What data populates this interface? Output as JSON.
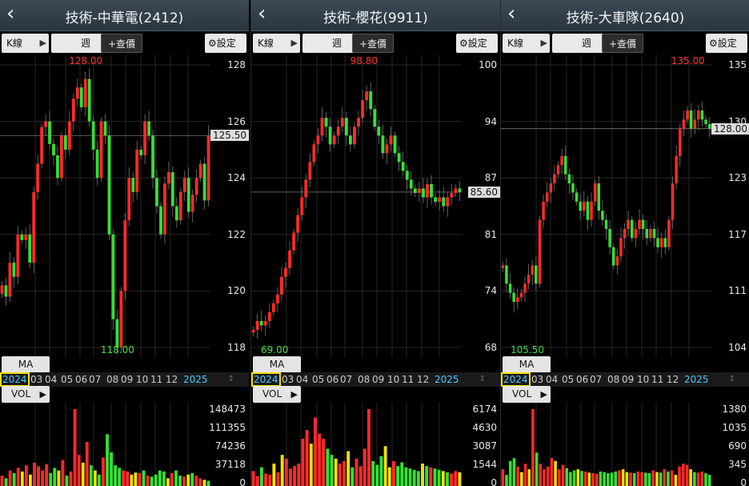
{
  "colors": {
    "up": "#ff2a2a",
    "down": "#35e035",
    "vol_yellow": "#f4e000",
    "accent_year": "#4cc4ff",
    "highlight": "#f0e000"
  },
  "toolbar": {
    "k_label": "K線",
    "week_label": "週",
    "query_label": "+查價",
    "setting_label": "設定",
    "back_icon": "chevron-left-icon",
    "setting_icon": "gear-icon"
  },
  "indicators": {
    "ma_label": "MA",
    "vol_label": "VOL"
  },
  "panels": [
    {
      "title": "技術-中華電(2412)",
      "high_label": "128.00",
      "low_label": "118.00",
      "last_label": "125.50",
      "y_ticks": [
        "128",
        "126",
        "124",
        "122",
        "120",
        "118"
      ],
      "vol_ticks": [
        "148473",
        "111355",
        "74236",
        "37118",
        "0"
      ],
      "timeline": [
        "2024",
        "03",
        "04",
        "05",
        "06",
        "07",
        "08",
        "09",
        "10",
        "11",
        "12",
        "2025"
      ]
    },
    {
      "title": "技術-櫻花(9911)",
      "high_label": "98.80",
      "low_label": "69.00",
      "last_label": "85.60",
      "y_ticks": [
        "100",
        "94",
        "87",
        "81",
        "74",
        "68"
      ],
      "vol_ticks": [
        "6174",
        "4630",
        "3087",
        "1544",
        "0"
      ],
      "timeline": [
        "2024",
        "03",
        "04",
        "05",
        "06",
        "07",
        "08",
        "09",
        "10",
        "11",
        "12",
        "2025"
      ]
    },
    {
      "title": "技術-大車隊(2640)",
      "high_label": "135.00",
      "low_label": "105.50",
      "last_label": "128.00",
      "y_ticks": [
        "135",
        "130",
        "123",
        "117",
        "111",
        "104"
      ],
      "vol_ticks": [
        "1380",
        "1035",
        "690",
        "345",
        "0"
      ],
      "timeline": [
        "2024",
        "03",
        "04",
        "05",
        "06",
        "07",
        "08",
        "09",
        "10",
        "11",
        "12",
        "2025"
      ]
    }
  ],
  "chart_data": [
    {
      "type": "candlestick",
      "title": "技術-中華電(2412)",
      "ylim": [
        118,
        128
      ],
      "last": 125.5,
      "closes": [
        120.2,
        119.8,
        121,
        120.5,
        122,
        121.8,
        122,
        121,
        123.5,
        124.5,
        125.8,
        126,
        125.2,
        124.8,
        124,
        125.5,
        125,
        126,
        126.8,
        127.2,
        126.5,
        127.5,
        126,
        125,
        124,
        126,
        125.5,
        122,
        119,
        118,
        120,
        122.5,
        124,
        123.5,
        125,
        124.8,
        126,
        125.5,
        124,
        123,
        122,
        123.8,
        124.2,
        123,
        122.5,
        123.5,
        124,
        122.8,
        123.4,
        124,
        124.5,
        123.2,
        125.5
      ],
      "volume": [
        20000,
        15000,
        30000,
        25000,
        35000,
        28000,
        40000,
        22000,
        45000,
        38000,
        30000,
        42000,
        25000,
        35000,
        30000,
        50000,
        20000,
        28000,
        148473,
        60000,
        45000,
        85000,
        40000,
        30000,
        22000,
        55000,
        100000,
        65000,
        40000,
        35000,
        30000,
        28000,
        22000,
        26000,
        25000,
        30000,
        20000,
        18000,
        22000,
        30000,
        28000,
        15000,
        25000,
        30000,
        20000,
        18000,
        22000,
        25000,
        20000,
        15000,
        12000,
        10000
      ]
    },
    {
      "type": "candlestick",
      "title": "技術-櫻花(9911)",
      "ylim": [
        68,
        100
      ],
      "last": 85.6,
      "closes": [
        70,
        71,
        70.5,
        71,
        72,
        73,
        74,
        76,
        77,
        79,
        81,
        83,
        85,
        87,
        89,
        91,
        92,
        94,
        93,
        91,
        92,
        93,
        94,
        92,
        91,
        93,
        94,
        96,
        97,
        95,
        93,
        92,
        90,
        91,
        92,
        90,
        89,
        88,
        87,
        86,
        85.5,
        86,
        85,
        86.5,
        85,
        84.5,
        85,
        84,
        85,
        85.5,
        86,
        85.6
      ],
      "volume": [
        1200,
        800,
        1500,
        1000,
        900,
        1800,
        1100,
        2500,
        2200,
        1400,
        1600,
        1800,
        3800,
        4500,
        3400,
        5500,
        4200,
        3800,
        3000,
        2500,
        2200,
        1800,
        2000,
        2800,
        1500,
        2200,
        1600,
        3000,
        6174,
        2000,
        1700,
        2400,
        3200,
        1500,
        2000,
        1600,
        1900,
        1500,
        1400,
        1300,
        1200,
        1800,
        1600,
        1500,
        1400,
        1300,
        1200,
        1100,
        1000,
        1200,
        1100
      ]
    },
    {
      "type": "candlestick",
      "title": "技術-大車隊(2640)",
      "ylim": [
        104,
        135
      ],
      "last": 128,
      "closes": [
        113,
        111,
        110,
        109,
        109.5,
        110,
        111,
        112,
        113,
        111,
        118,
        120,
        121,
        122,
        123,
        124,
        125,
        123,
        122,
        121,
        120,
        119,
        120,
        118,
        120,
        122,
        119,
        118,
        117,
        115,
        113,
        114,
        116,
        117,
        118,
        116,
        117,
        118,
        117,
        116,
        117,
        116,
        115,
        116,
        115,
        118,
        122,
        125,
        128,
        129,
        130,
        128,
        129,
        130,
        129,
        128.5,
        128
      ],
      "volume": [
        300,
        200,
        450,
        500,
        350,
        250,
        400,
        300,
        1380,
        600,
        400,
        300,
        350,
        500,
        450,
        300,
        380,
        320,
        250,
        280,
        300,
        270,
        260,
        240,
        230,
        220,
        260,
        250,
        230,
        240,
        260,
        280,
        300,
        250,
        240,
        230,
        260,
        250,
        240,
        230,
        280,
        250,
        240,
        300,
        260,
        280,
        200,
        350,
        400,
        380,
        300,
        250,
        240,
        260,
        230,
        200
      ]
    }
  ]
}
